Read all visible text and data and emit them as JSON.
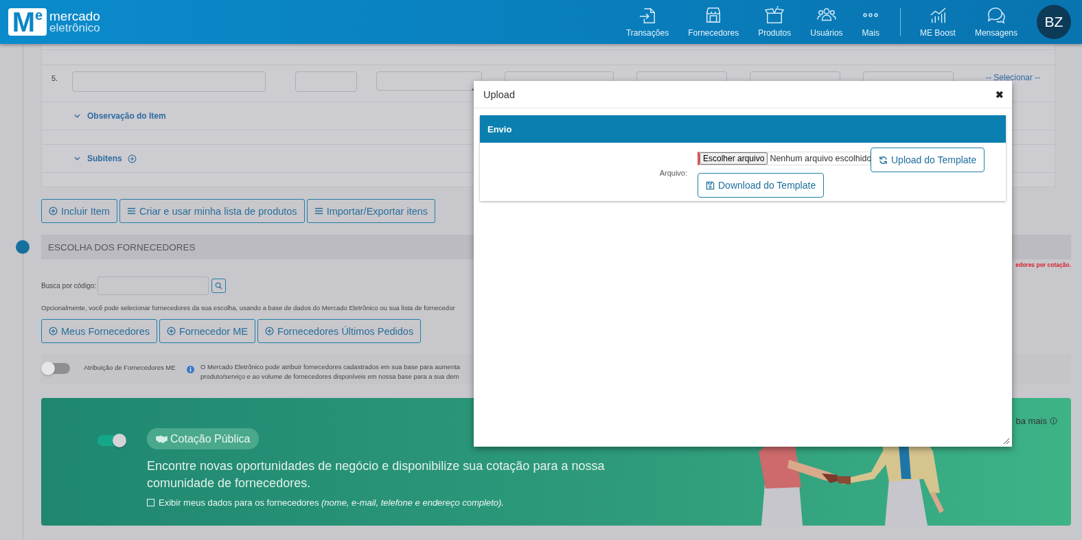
{
  "header": {
    "logo": {
      "mark": "M",
      "mark_sup": "e",
      "name_top": "mercado",
      "name_bottom": "eletrônico"
    },
    "nav": [
      {
        "label": "Transações"
      },
      {
        "label": "Fornecedores"
      },
      {
        "label": "Produtos"
      },
      {
        "label": "Usuários"
      },
      {
        "label": "Mais"
      }
    ],
    "nav_extra": [
      {
        "label": "ME Boost"
      },
      {
        "label": "Mensagens"
      }
    ],
    "avatar": "BZ"
  },
  "items": {
    "row_number": "5.",
    "select_placeholder": "-- Selecionar --",
    "sections": [
      {
        "label": "Observação do Item",
        "kind": "note"
      },
      {
        "label": "Subitens",
        "kind": "subitems"
      }
    ],
    "actions": [
      {
        "label": "Incluir Item",
        "kind": "add"
      },
      {
        "label": "Criar e usar minha lista de produtos",
        "kind": "list"
      },
      {
        "label": "Importar/Exportar itens",
        "kind": "list"
      }
    ]
  },
  "suppliers": {
    "title": "ESCOLHA DOS FORNECEDORES",
    "warning": "edores por cotação.",
    "search": {
      "label": "Busca por código:"
    },
    "description": "Opcionalmente, você pode selecionar fornecedores da sua escolha, usando a base de dados do Mercado Eletrônico ou sua lista de fornecedor",
    "buttons": [
      {
        "label": "Meus Fornecedores"
      },
      {
        "label": "Fornecedor ME"
      },
      {
        "label": "Fornecedores Últimos Pedidos"
      }
    ],
    "auto_assign": {
      "label": "Atribuição de Fornecedores ME",
      "on": false,
      "info_lines": [
        "O Mercado Eletrônico pode atribuir fornecedores cadastrados em sua base para aumenta",
        "produto/serviço e ao volume de fornecedores disponíveis em nossa base para a sua dem"
      ]
    }
  },
  "public_quote": {
    "on": true,
    "badge": "Cotação Pública",
    "text": "Encontre novas oportunidades de negócio e disponibilize sua cotação para a nossa comunidade de fornecedores.",
    "checkbox": {
      "label": "Exibir meus dados para os fornecedores *(nome, e-mail, telefone e endereço completo).*",
      "checked": false
    },
    "more": "ba mais"
  },
  "modal": {
    "title": "Upload",
    "close": "✖",
    "panel_title": "Envio",
    "field_label": "Arquivo:",
    "file_button": "Escolher arquivo",
    "file_status": "Nenhum arquivo escolhido",
    "buttons": [
      {
        "label": "Upload do Template",
        "kind": "upload"
      },
      {
        "label": "Download do Template",
        "kind": "download"
      }
    ]
  }
}
